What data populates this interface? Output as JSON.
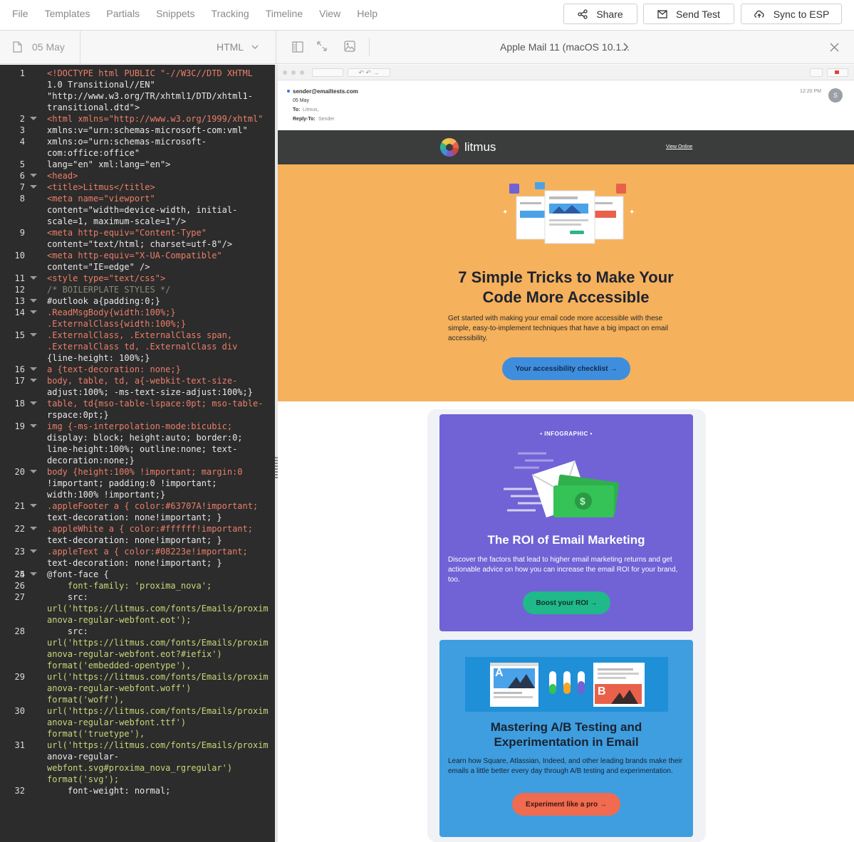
{
  "menu": [
    "File",
    "Templates",
    "Partials",
    "Snippets",
    "Tracking",
    "Timeline",
    "View",
    "Help"
  ],
  "actions": {
    "share": "Share",
    "send_test": "Send Test",
    "sync": "Sync to ESP"
  },
  "file": {
    "name": "05 May",
    "mode": "HTML"
  },
  "preview": {
    "client": "Apple Mail 11 (macOS 10.1..."
  },
  "mail": {
    "from": "sender@emailtests.com",
    "subject": "05 May",
    "to_label": "To:",
    "to": "Litmus,",
    "reply_label": "Reply-To:",
    "reply": "Sender",
    "time": "12:20 PM",
    "avatar": "S"
  },
  "email": {
    "brand": "litmus",
    "view_online": "View Online",
    "hero_title_1": "7 Simple Tricks to Make Your",
    "hero_title_2": "Code More Accessible",
    "hero_body": "Get started with making your email code more accessible with these simple, easy-to-implement techniques that have a big impact on email accessibility.",
    "hero_cta": "Your accessibility checklist →",
    "card1_kicker": "• INFOGRAPHIC •",
    "card1_title": "The ROI of Email Marketing",
    "card1_body": "Discover the factors that lead to higher email marketing returns and get actionable advice on how you can increase the email ROI for your brand, too.",
    "card1_cta": "Boost your ROI →",
    "card2_title_1": "Mastering A/B Testing and",
    "card2_title_2": "Experimentation in Email",
    "card2_body": "Learn how Square, Atlassian, Indeed, and other leading brands make their emails a little better every day through A/B testing and experimentation.",
    "card2_cta": "Experiment like a pro →",
    "ab_a": "A",
    "ab_b": "B"
  },
  "colors": {
    "editor_bg": "#2b2c2b",
    "hero": "#f5b15c",
    "purple": "#7162d6",
    "blue": "#3f9ee0",
    "teal": "#1fb98a",
    "orange": "#f06b4f",
    "hero_btn": "#3f8ede"
  },
  "code_lines": [
    {
      "n": "1",
      "fold": false,
      "t": [
        "<!DOCTYPE html PUBLIC \"-//W3C//DTD XHTML",
        "1.0 Transitional//EN\"",
        "\"http://www.w3.org/TR/xhtml1/DTD/xhtml1-",
        "transitional.dtd\">"
      ]
    },
    {
      "n": "2",
      "fold": true,
      "t": [
        "<html xmlns=\"http://www.w3.org/1999/xhtml\""
      ]
    },
    {
      "n": "3",
      "fold": false,
      "t": [
        "xmlns:v=\"urn:schemas-microsoft-com:vml\""
      ]
    },
    {
      "n": "4",
      "fold": false,
      "t": [
        "xmlns:o=\"urn:schemas-microsoft-",
        "com:office:office\""
      ]
    },
    {
      "n": "5",
      "fold": false,
      "t": [
        "lang=\"en\" xml:lang=\"en\">"
      ]
    },
    {
      "n": "6",
      "fold": true,
      "t": [
        "<head>"
      ]
    },
    {
      "n": "7",
      "fold": true,
      "t": [
        "<title>Litmus</title>"
      ]
    },
    {
      "n": "8",
      "fold": false,
      "t": [
        "<meta name=\"viewport\"",
        "content=\"width=device-width, initial-",
        "scale=1, maximum-scale=1\"/>"
      ]
    },
    {
      "n": "9",
      "fold": false,
      "t": [
        "<meta http-equiv=\"Content-Type\"",
        "content=\"text/html; charset=utf-8\"/>"
      ]
    },
    {
      "n": "10",
      "fold": false,
      "t": [
        "<meta http-equiv=\"X-UA-Compatible\"",
        "content=\"IE=edge\" />"
      ]
    },
    {
      "n": "11",
      "fold": true,
      "t": [
        "<style type=\"text/css\">"
      ]
    },
    {
      "n": "12",
      "fold": false,
      "t": [
        "/* BOILERPLATE STYLES */"
      ]
    },
    {
      "n": "13",
      "fold": true,
      "t": [
        "#outlook a{padding:0;}"
      ]
    },
    {
      "n": "14",
      "fold": true,
      "t": [
        ".ReadMsgBody{width:100%;}",
        ".ExternalClass{width:100%;}"
      ]
    },
    {
      "n": "15",
      "fold": true,
      "t": [
        ".ExternalClass, .ExternalClass span,",
        ".ExternalClass td, .ExternalClass div",
        "{line-height: 100%;}"
      ]
    },
    {
      "n": "16",
      "fold": true,
      "t": [
        "a {text-decoration: none;}"
      ]
    },
    {
      "n": "17",
      "fold": true,
      "t": [
        "body, table, td, a{-webkit-text-size-",
        "adjust:100%; -ms-text-size-adjust:100%;}"
      ]
    },
    {
      "n": "18",
      "fold": true,
      "t": [
        "table, td{mso-table-lspace:0pt; mso-table-",
        "rspace:0pt;}"
      ]
    },
    {
      "n": "19",
      "fold": true,
      "t": [
        "img {-ms-interpolation-mode:bicubic;",
        "display: block; height:auto; border:0;",
        "line-height:100%; outline:none; text-",
        "decoration:none;}"
      ]
    },
    {
      "n": "20",
      "fold": true,
      "t": [
        "body {height:100% !important; margin:0",
        "!important; padding:0 !important;",
        "width:100% !important;}"
      ]
    },
    {
      "n": "21",
      "fold": true,
      "t": [
        ".appleFooter a { color:#63707A!important;",
        "text-decoration: none!important; }"
      ]
    },
    {
      "n": "22",
      "fold": true,
      "t": [
        ".appleWhite a { color:#ffffff!important;",
        "text-decoration: none!important; }"
      ]
    },
    {
      "n": "23",
      "fold": true,
      "t": [
        ".appleText a { color:#08223e!important;",
        "text-decoration: none!important; }"
      ]
    },
    {
      "n": "24",
      "fold": false,
      "t": [
        ""
      ]
    },
    {
      "n": "25",
      "fold": true,
      "t": [
        "@font-face {"
      ]
    },
    {
      "n": "26",
      "fold": false,
      "t": [
        "    font-family: 'proxima_nova';"
      ]
    },
    {
      "n": "27",
      "fold": false,
      "t": [
        "    src:",
        "url('https://litmus.com/fonts/Emails/proxim",
        "anova-regular-webfont.eot');"
      ]
    },
    {
      "n": "28",
      "fold": false,
      "t": [
        "    src:",
        "url('https://litmus.com/fonts/Emails/proxim",
        "anova-regular-webfont.eot?#iefix')",
        "format('embedded-opentype'),"
      ]
    },
    {
      "n": "29",
      "fold": false,
      "t": [
        "",
        "url('https://litmus.com/fonts/Emails/proxim",
        "anova-regular-webfont.woff')",
        "format('woff'),"
      ]
    },
    {
      "n": "30",
      "fold": false,
      "t": [
        "",
        "url('https://litmus.com/fonts/Emails/proxim",
        "anova-regular-webfont.ttf')",
        "format('truetype'),"
      ]
    },
    {
      "n": "31",
      "fold": false,
      "t": [
        "",
        "url('https://litmus.com/fonts/Emails/proxim",
        "anova-regular-",
        "webfont.svg#proxima_nova_rgregular')",
        "format('svg');"
      ]
    },
    {
      "n": "32",
      "fold": false,
      "t": [
        "    font-weight: normal;"
      ]
    }
  ]
}
